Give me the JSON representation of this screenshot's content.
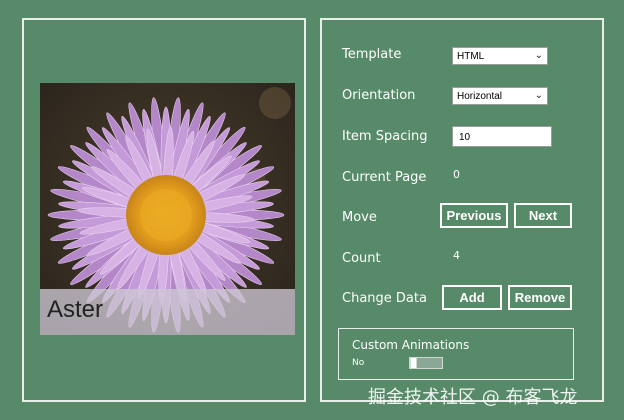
{
  "flipview": {
    "caption": "Aster"
  },
  "settings": {
    "template": {
      "label": "Template",
      "value": "HTML"
    },
    "orientation": {
      "label": "Orientation",
      "value": "Horizontal"
    },
    "item_spacing": {
      "label": "Item Spacing",
      "value": "10"
    },
    "current_page": {
      "label": "Current Page",
      "value": "0"
    },
    "move": {
      "label": "Move",
      "previous": "Previous",
      "next": "Next"
    },
    "count": {
      "label": "Count",
      "value": "4"
    },
    "change_data": {
      "label": "Change Data",
      "add": "Add",
      "remove": "Remove"
    },
    "custom_animations": {
      "title": "Custom Animations",
      "state": "No"
    }
  },
  "watermark": "掘金技术社区 @ 布客飞龙",
  "colors": {
    "background": "#568a68",
    "panel_border": "#e8efe9",
    "flower_petal": "#c59ad8",
    "flower_center": "#e3a21f"
  }
}
